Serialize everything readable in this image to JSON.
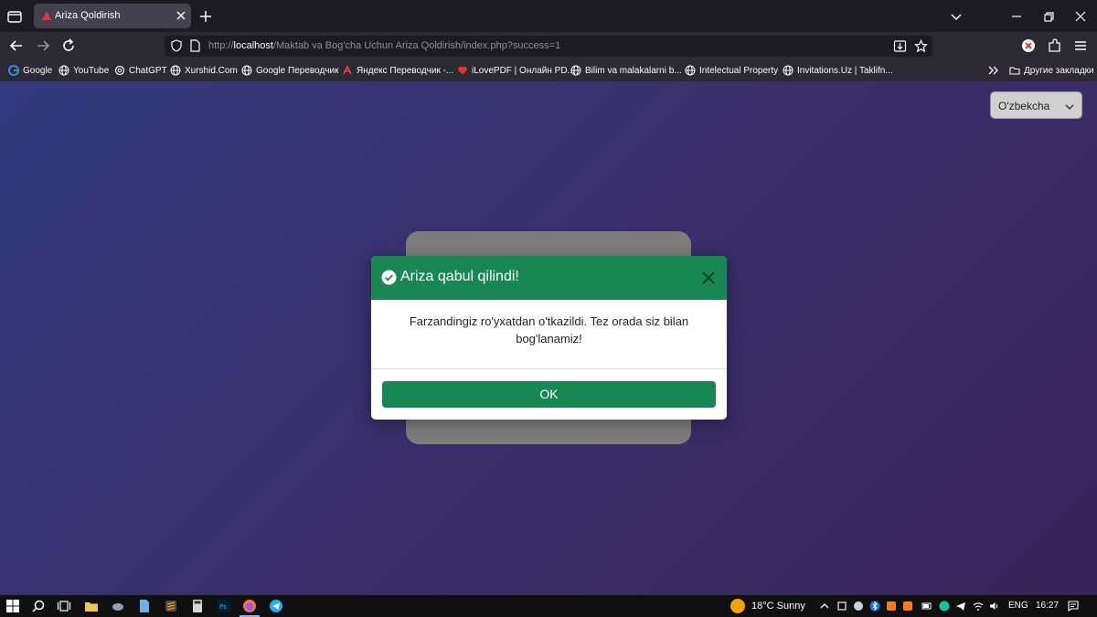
{
  "browser": {
    "tab_title": "Ariza Qoldirish",
    "url_prefix": "http://",
    "url_host": "localhost",
    "url_path": "/Maktab va Bog'cha Uchun Ariza Qoldirish/index.php?success=1"
  },
  "bookmarks": [
    {
      "label": "Google",
      "icon": "google-icon"
    },
    {
      "label": "YouTube",
      "icon": "globe-icon"
    },
    {
      "label": "ChatGPT",
      "icon": "chatgpt-icon"
    },
    {
      "label": "Xurshid.Com",
      "icon": "globe-icon"
    },
    {
      "label": "Google Переводчик",
      "icon": "globe-icon"
    },
    {
      "label": "Яндекс Переводчик -...",
      "icon": "yandex-icon"
    },
    {
      "label": "iLovePDF | Онлайн PD...",
      "icon": "heart-icon"
    },
    {
      "label": "Bilim va malakalarni b...",
      "icon": "globe-icon"
    },
    {
      "label": "Intelectual Property",
      "icon": "globe-icon"
    },
    {
      "label": "Invitations.Uz | Taklifn...",
      "icon": "globe-icon"
    }
  ],
  "other_bookmarks": "Другие закладки",
  "language_select": {
    "selected": "O'zbekcha"
  },
  "modal": {
    "title": "Ariza qabul qilindi!",
    "message": "Farzandingiz ro'yxatdan o'tkazildi. Tez orada siz bilan bog'lanamiz!",
    "ok_label": "OK"
  },
  "taskbar": {
    "weather": "18°C  Sunny",
    "language": "ENG",
    "time": "16:27"
  },
  "colors": {
    "success_green": "#198754",
    "page_gradient_start": "#333a7e",
    "page_gradient_end": "#3a2658"
  }
}
